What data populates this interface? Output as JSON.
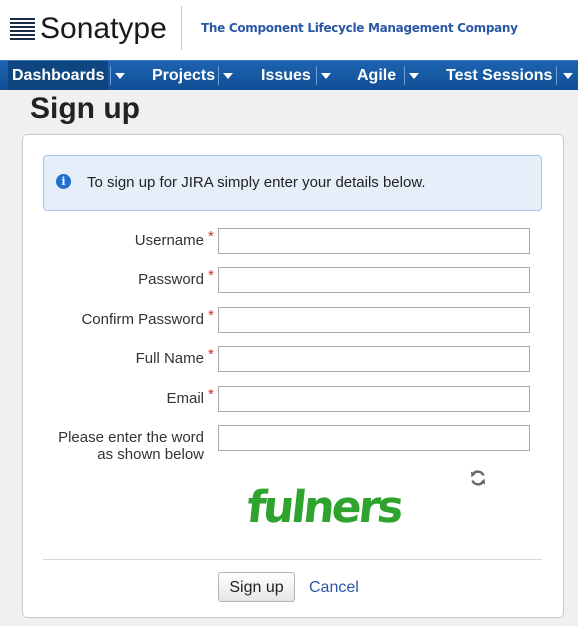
{
  "header": {
    "brand": "Sonatype",
    "tagline": "The Component Lifecycle Management Company"
  },
  "nav": {
    "items": [
      {
        "label": "Dashboards"
      },
      {
        "label": "Projects"
      },
      {
        "label": "Issues"
      },
      {
        "label": "Agile"
      },
      {
        "label": "Test Sessions"
      }
    ]
  },
  "page": {
    "title": "Sign up"
  },
  "info": {
    "icon": "info-icon",
    "text": "To sign up for JIRA simply enter your details below."
  },
  "form": {
    "required_marker": "*",
    "fields": [
      {
        "label": "Username",
        "value": "",
        "required": true
      },
      {
        "label": "Password",
        "value": "",
        "required": true
      },
      {
        "label": "Confirm Password",
        "value": "",
        "required": true
      },
      {
        "label": "Full Name",
        "value": "",
        "required": true
      },
      {
        "label": "Email",
        "value": "",
        "required": true
      }
    ],
    "captcha": {
      "label_line1": "Please enter the word",
      "label_line2": "as shown below",
      "value": "",
      "word": "fulners",
      "refresh_icon": "refresh-icon"
    },
    "submit_label": "Sign up",
    "cancel_label": "Cancel"
  },
  "colors": {
    "nav_bg": "#1d63b0",
    "link": "#2b58a5",
    "required": "#c0392b",
    "captcha_green": "#2ea32e"
  }
}
